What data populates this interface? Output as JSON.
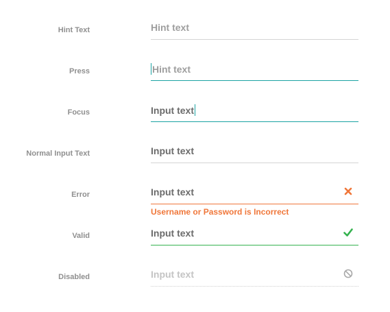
{
  "colors": {
    "label": "#8f8f8f",
    "hint": "#9e9e9e",
    "text": "#6b6b6b",
    "divider": "#d4d4d4",
    "focus": "#1aa3a3",
    "error": "#f0773a",
    "valid": "#35b24f",
    "disabled": "#c4c4c4"
  },
  "rows": {
    "hint": {
      "label": "Hint Text",
      "value": "Hint text"
    },
    "press": {
      "label": "Press",
      "value": "Hint text"
    },
    "focus": {
      "label": "Focus",
      "value": "Input text"
    },
    "normal": {
      "label": "Normal Input Text",
      "value": "Input text"
    },
    "error": {
      "label": "Error",
      "value": "Input text",
      "message": "Username or Password is Incorrect",
      "icon": "close-icon"
    },
    "valid": {
      "label": "Valid",
      "value": "Input text",
      "icon": "check-icon"
    },
    "disabled": {
      "label": "Disabled",
      "value": "Input text",
      "icon": "block-icon"
    }
  }
}
